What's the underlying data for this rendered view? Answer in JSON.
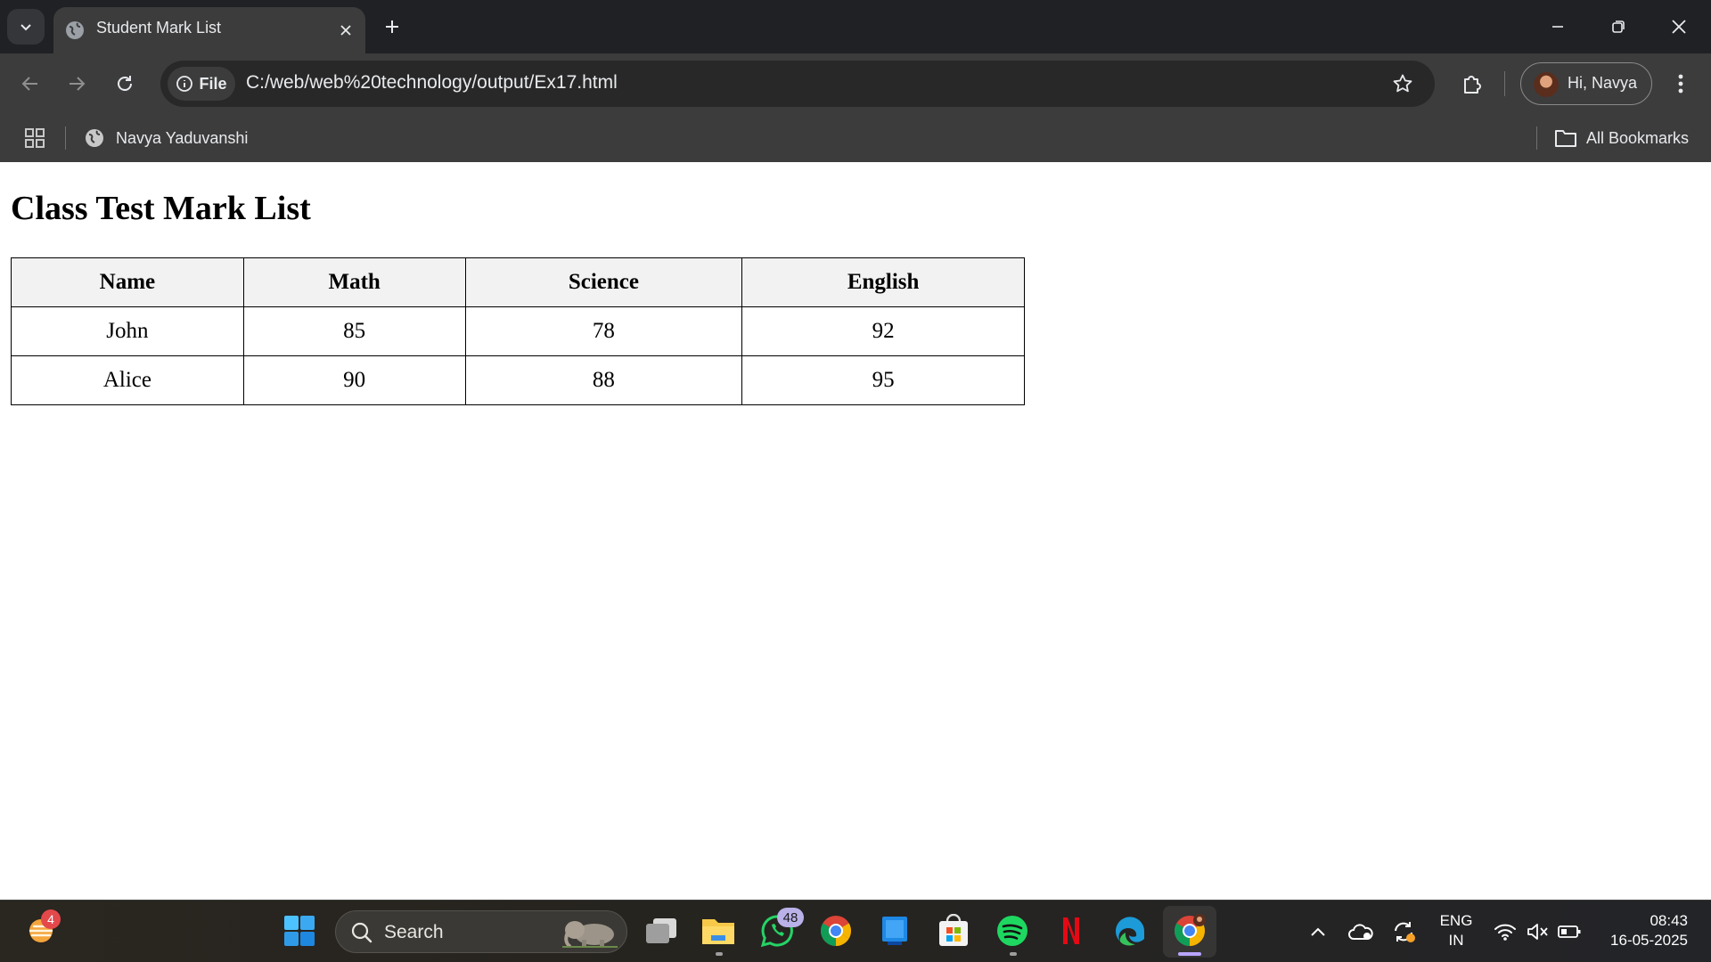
{
  "browser": {
    "tab": {
      "title": "Student Mark List"
    },
    "address": {
      "chip_label": "File",
      "url": "C:/web/web%20technology/output/Ex17.html"
    },
    "profile": {
      "label": "Hi, Navya"
    },
    "bookmarks": {
      "items": [
        {
          "label": "Navya Yaduvanshi"
        }
      ],
      "all_label": "All Bookmarks"
    }
  },
  "page": {
    "heading": "Class Test Mark List",
    "table": {
      "headers": [
        "Name",
        "Math",
        "Science",
        "English"
      ],
      "rows": [
        [
          "John",
          "85",
          "78",
          "92"
        ],
        [
          "Alice",
          "90",
          "88",
          "95"
        ]
      ]
    }
  },
  "taskbar": {
    "weather_badge": "4",
    "search_label": "Search",
    "whatsapp_badge": "48",
    "lang_line1": "ENG",
    "lang_line2": "IN",
    "time": "08:43",
    "date": "16-05-2025"
  },
  "colors": {
    "tabstrip": "#202124",
    "toolbar": "#3c3c3c",
    "table_header_bg": "#f2f2f2",
    "taskbar": "#26241f",
    "accent": "#b9a6ff"
  },
  "icons": [
    "tab-search-icon",
    "globe-icon",
    "close-icon",
    "plus-icon",
    "minimize-icon",
    "restore-icon",
    "back-icon",
    "forward-icon",
    "reload-icon",
    "info-icon",
    "star-icon",
    "extensions-icon",
    "kebab-menu-icon",
    "apps-grid-icon",
    "folder-icon",
    "windows-start-icon",
    "search-icon",
    "task-view-icon",
    "file-explorer-icon",
    "whatsapp-icon",
    "chrome-icon",
    "app-icon",
    "store-icon",
    "spotify-icon",
    "netflix-icon",
    "edge-icon",
    "chevron-up-icon",
    "onedrive-icon",
    "sync-icon",
    "wifi-icon",
    "mute-icon",
    "battery-icon"
  ]
}
